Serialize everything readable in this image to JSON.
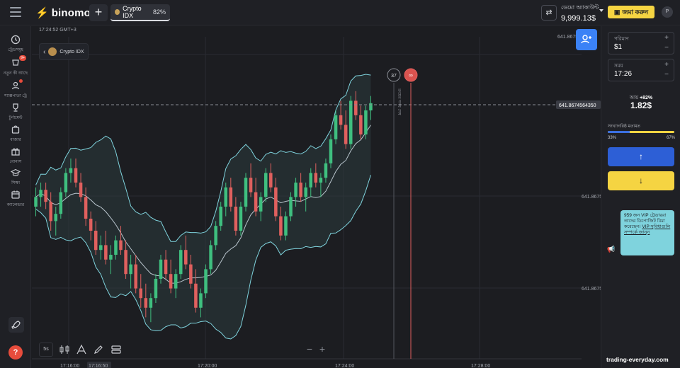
{
  "topbar": {
    "logo_text": "binomo",
    "add_tab_label": "+",
    "asset_tab": {
      "name": "Crypto IDX",
      "payout": "82%"
    },
    "account_label": "ডেমো অ্যাকাউন্ট",
    "balance": "9,999.13$",
    "deposit_label": "জমা করুন",
    "avatar_letter": "P"
  },
  "sidebar": {
    "items": [
      {
        "label": "ট্রেডসমূহ",
        "icon": "clock-icon"
      },
      {
        "label": "নতুন কী আছে",
        "icon": "gift-icon",
        "badge": "9+"
      },
      {
        "label": "শ্যাক্সপাতা ট্রে",
        "icon": "users-icon",
        "dot": true
      },
      {
        "label": "টুর্নামেন্ট",
        "icon": "trophy-icon"
      },
      {
        "label": "বাজার",
        "icon": "bag-icon"
      },
      {
        "label": "বোনাস",
        "icon": "gift-box-icon"
      },
      {
        "label": "শিক্ষা",
        "icon": "graduation-icon"
      },
      {
        "label": "ক্যালেন্ডার",
        "icon": "calendar-icon"
      }
    ]
  },
  "chart": {
    "clock": "17:24:52 GMT+3",
    "asset_name": "Crypto IDX",
    "current_price": "641.8674564350",
    "price_labels": [
      "641.8675",
      "641.8675",
      "641.8675"
    ],
    "top_price_label": "641.8675",
    "time_labels": [
      "17:16:00",
      "17:16:50",
      "17:20:00",
      "17:24:00",
      "17:28:00"
    ],
    "timer_seconds": "37",
    "timer_close": "∞",
    "vertical_label": "ক্রয়ের সময় শেষ",
    "timeframe": "5s"
  },
  "chart_data": {
    "type": "candlestick",
    "series": [
      {
        "name": "",
        "values": [
          [
            0.5,
            0.58,
            0.46,
            0.54
          ],
          [
            0.54,
            0.6,
            0.5,
            0.57
          ],
          [
            0.57,
            0.6,
            0.49,
            0.52
          ],
          [
            0.52,
            0.56,
            0.4,
            0.44
          ],
          [
            0.44,
            0.5,
            0.38,
            0.47
          ],
          [
            0.47,
            0.58,
            0.45,
            0.56
          ],
          [
            0.56,
            0.66,
            0.54,
            0.64
          ],
          [
            0.64,
            0.7,
            0.6,
            0.66
          ],
          [
            0.66,
            0.7,
            0.58,
            0.6
          ],
          [
            0.6,
            0.64,
            0.52,
            0.54
          ],
          [
            0.54,
            0.58,
            0.42,
            0.45
          ],
          [
            0.45,
            0.48,
            0.36,
            0.4
          ],
          [
            0.4,
            0.44,
            0.3,
            0.32
          ],
          [
            0.32,
            0.38,
            0.28,
            0.34
          ],
          [
            0.34,
            0.4,
            0.26,
            0.28
          ],
          [
            0.28,
            0.34,
            0.22,
            0.3
          ],
          [
            0.3,
            0.38,
            0.28,
            0.36
          ],
          [
            0.36,
            0.42,
            0.3,
            0.32
          ],
          [
            0.32,
            0.36,
            0.2,
            0.22
          ],
          [
            0.22,
            0.3,
            0.16,
            0.26
          ],
          [
            0.26,
            0.3,
            0.14,
            0.16
          ],
          [
            0.16,
            0.22,
            0.08,
            0.12
          ],
          [
            0.12,
            0.18,
            0.04,
            0.08
          ],
          [
            0.08,
            0.14,
            0.02,
            0.12
          ],
          [
            0.12,
            0.22,
            0.1,
            0.2
          ],
          [
            0.2,
            0.3,
            0.18,
            0.28
          ],
          [
            0.28,
            0.32,
            0.2,
            0.22
          ],
          [
            0.22,
            0.28,
            0.14,
            0.16
          ],
          [
            0.16,
            0.24,
            0.12,
            0.22
          ],
          [
            0.22,
            0.34,
            0.2,
            0.32
          ],
          [
            0.32,
            0.38,
            0.24,
            0.26
          ],
          [
            0.26,
            0.3,
            0.16,
            0.18
          ],
          [
            0.18,
            0.24,
            0.06,
            0.08
          ],
          [
            0.08,
            0.16,
            0.04,
            0.14
          ],
          [
            0.14,
            0.26,
            0.12,
            0.24
          ],
          [
            0.24,
            0.36,
            0.22,
            0.34
          ],
          [
            0.34,
            0.44,
            0.32,
            0.42
          ],
          [
            0.42,
            0.52,
            0.4,
            0.5
          ],
          [
            0.5,
            0.6,
            0.46,
            0.58
          ],
          [
            0.58,
            0.62,
            0.48,
            0.5
          ],
          [
            0.5,
            0.54,
            0.38,
            0.4
          ],
          [
            0.4,
            0.52,
            0.38,
            0.5
          ],
          [
            0.5,
            0.64,
            0.48,
            0.62
          ],
          [
            0.62,
            0.68,
            0.54,
            0.56
          ],
          [
            0.56,
            0.62,
            0.46,
            0.48
          ],
          [
            0.48,
            0.56,
            0.44,
            0.54
          ],
          [
            0.54,
            0.66,
            0.52,
            0.64
          ],
          [
            0.64,
            0.68,
            0.56,
            0.58
          ],
          [
            0.58,
            0.62,
            0.44,
            0.46
          ],
          [
            0.46,
            0.5,
            0.36,
            0.38
          ],
          [
            0.38,
            0.48,
            0.36,
            0.46
          ],
          [
            0.46,
            0.56,
            0.44,
            0.54
          ],
          [
            0.54,
            0.62,
            0.5,
            0.6
          ],
          [
            0.6,
            0.64,
            0.52,
            0.54
          ],
          [
            0.54,
            0.6,
            0.48,
            0.58
          ],
          [
            0.58,
            0.66,
            0.54,
            0.64
          ],
          [
            0.64,
            0.68,
            0.58,
            0.6
          ],
          [
            0.6,
            0.64,
            0.54,
            0.62
          ],
          [
            0.62,
            0.7,
            0.6,
            0.68
          ],
          [
            0.68,
            0.8,
            0.66,
            0.78
          ],
          [
            0.78,
            0.9,
            0.76,
            0.88
          ],
          [
            0.88,
            0.94,
            0.82,
            0.84
          ],
          [
            0.84,
            0.9,
            0.74,
            0.76
          ],
          [
            0.76,
            0.96,
            0.74,
            0.94
          ],
          [
            0.94,
            0.98,
            0.86,
            0.88
          ],
          [
            0.88,
            0.92,
            0.78,
            0.8
          ],
          [
            0.8,
            0.92,
            0.78,
            0.9
          ],
          [
            0.9,
            0.96,
            0.86,
            0.93
          ]
        ]
      }
    ],
    "x_labels": [
      "17:16:00",
      "17:16:50",
      "17:20:00",
      "17:24:00",
      "17:28:00"
    ],
    "y_labels": [
      "641.8675",
      "641.8675",
      "641.8675"
    ],
    "colors": {
      "up": "#3fbf7f",
      "down": "#e0605e",
      "band": "#7fd3dd",
      "mid": "#b8c4cc"
    }
  },
  "right_panel": {
    "amount_label": "পরিমাণ",
    "amount_value": "$1",
    "time_label": "সময়",
    "time_value": "17:26",
    "income_label": "আয়",
    "income_pct": "+82%",
    "income_value": "1.82$",
    "sentiment_label": "সংখ্যাগরিষ্ঠ মতামত",
    "sentiment_up": "33%",
    "sentiment_down": "67%",
    "sentiment_up_fraction": 0.33,
    "up_arrow": "↑",
    "down_arrow": "↓",
    "vip_text_1": "959 জন VIP ট্রেডাররা তাদের ডিপোজিট বিমা করেছেন।",
    "vip_link": "VIP সুবিধাগুলি সম্পর্কে জানুন",
    "colors": {
      "up": "#2d5fd6",
      "down": "#f5d442"
    }
  },
  "watermark": "trading-everyday.com"
}
